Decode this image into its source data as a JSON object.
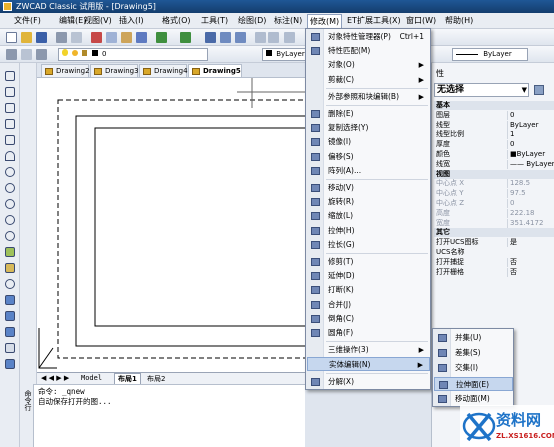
{
  "window": {
    "title": "ZWCAD Classic 试用版 - [Drawing5]"
  },
  "menubar": [
    {
      "label": "文件(F)",
      "active": false
    },
    {
      "label": "编辑(E)",
      "active": false
    },
    {
      "label": "视图(V)",
      "active": false
    },
    {
      "label": "插入(I)",
      "active": false
    },
    {
      "label": "格式(O)",
      "active": false
    },
    {
      "label": "工具(T)",
      "active": false
    },
    {
      "label": "绘图(D)",
      "active": false
    },
    {
      "label": "标注(N)",
      "active": false
    },
    {
      "label": "修改(M)",
      "active": true
    },
    {
      "label": "ET扩展工具(X)",
      "active": false
    },
    {
      "label": "窗口(W)",
      "active": false
    },
    {
      "label": "帮助(H)",
      "active": false
    }
  ],
  "toolbar": {
    "layer_value": "0",
    "color_value": "ByLayer",
    "linetype_value": "ByLayer"
  },
  "doc_tabs": [
    {
      "label": "Drawing2",
      "selected": false
    },
    {
      "label": "Drawing3",
      "selected": false
    },
    {
      "label": "Drawing4",
      "selected": false
    },
    {
      "label": "Drawing5",
      "selected": true
    }
  ],
  "layout_tabs": [
    "Model",
    "布局1",
    "布局2"
  ],
  "command": {
    "label": "命令行",
    "lines": [
      "命令: _qnew",
      "自动保存打开的图..."
    ]
  },
  "modify_menu": [
    {
      "label": "对象特性管理器(P)",
      "shortcut": "Ctrl+1",
      "icon": "properties-icon"
    },
    {
      "label": "特性匹配(M)",
      "icon": "match-properties-icon"
    },
    {
      "label": "对象(O)",
      "submenu": true
    },
    {
      "label": "剪裁(C)",
      "submenu": true
    },
    {
      "sep": true
    },
    {
      "label": "外部参照和块编辑(B)",
      "submenu": true
    },
    {
      "sep": true
    },
    {
      "label": "删除(E)",
      "icon": "erase-icon"
    },
    {
      "label": "复制选择(Y)",
      "icon": "copy-icon"
    },
    {
      "label": "镜像(I)",
      "icon": "mirror-icon"
    },
    {
      "label": "偏移(S)",
      "icon": "offset-icon"
    },
    {
      "label": "阵列(A)...",
      "icon": "array-icon"
    },
    {
      "sep": true
    },
    {
      "label": "移动(V)",
      "icon": "move-icon"
    },
    {
      "label": "旋转(R)",
      "icon": "rotate-icon"
    },
    {
      "label": "缩放(L)",
      "icon": "scale-icon"
    },
    {
      "label": "拉伸(H)",
      "icon": "stretch-icon"
    },
    {
      "label": "拉长(G)",
      "icon": "lengthen-icon"
    },
    {
      "sep": true
    },
    {
      "label": "修剪(T)",
      "icon": "trim-icon"
    },
    {
      "label": "延伸(D)",
      "icon": "extend-icon"
    },
    {
      "label": "打断(K)",
      "icon": "break-icon"
    },
    {
      "label": "合并(J)",
      "icon": "join-icon"
    },
    {
      "label": "倒角(C)",
      "icon": "chamfer-icon"
    },
    {
      "label": "圆角(F)",
      "icon": "fillet-icon"
    },
    {
      "sep": true
    },
    {
      "label": "三维操作(3)",
      "submenu": true
    },
    {
      "label": "实体编辑(N)",
      "submenu": true,
      "highlighted": true
    },
    {
      "sep": true
    },
    {
      "label": "分解(X)",
      "icon": "explode-icon"
    }
  ],
  "solid_edit_submenu": [
    {
      "label": "并集(U)",
      "icon": "union-icon"
    },
    {
      "label": "差集(S)",
      "icon": "subtract-icon"
    },
    {
      "label": "交集(I)",
      "icon": "intersect-icon"
    },
    {
      "label": "拉伸面(E)",
      "icon": "extrude-face-icon",
      "highlighted": true
    },
    {
      "label": "移动面(M)",
      "icon": "move-face-icon"
    }
  ],
  "properties": {
    "title": "性",
    "selector": "无选择",
    "rows": [
      {
        "k": "基本",
        "cat": true
      },
      {
        "k": "图层",
        "v": "0"
      },
      {
        "k": "线型",
        "v": "ByLayer"
      },
      {
        "k": "线型比例",
        "v": "1"
      },
      {
        "k": "厚度",
        "v": "0"
      },
      {
        "k": "颜色",
        "v": "■ByLayer"
      },
      {
        "k": "线宽",
        "v": "—— ByLayer"
      },
      {
        "k": "视图",
        "cat": true
      },
      {
        "k": "中心点 X",
        "v": "128.5",
        "dim": true
      },
      {
        "k": "中心点 Y",
        "v": "97.5",
        "dim": true
      },
      {
        "k": "中心点 Z",
        "v": "0",
        "dim": true
      },
      {
        "k": "高度",
        "v": "222.18",
        "dim": true
      },
      {
        "k": "宽度",
        "v": "351.4172",
        "dim": true
      },
      {
        "k": "其它",
        "cat": true
      },
      {
        "k": "打开UCS图标",
        "v": "是"
      },
      {
        "k": "UCS名称",
        "v": ""
      },
      {
        "k": "打开捕捉",
        "v": "否"
      },
      {
        "k": "打开栅格",
        "v": "否"
      }
    ]
  },
  "watermark": {
    "main": "资料网",
    "sub": "ZL.XS1616.COM"
  },
  "colors": {
    "title_bar": "#1f5796",
    "menu_highlight": "#c6d7ee",
    "canvas": "#ffffff"
  }
}
